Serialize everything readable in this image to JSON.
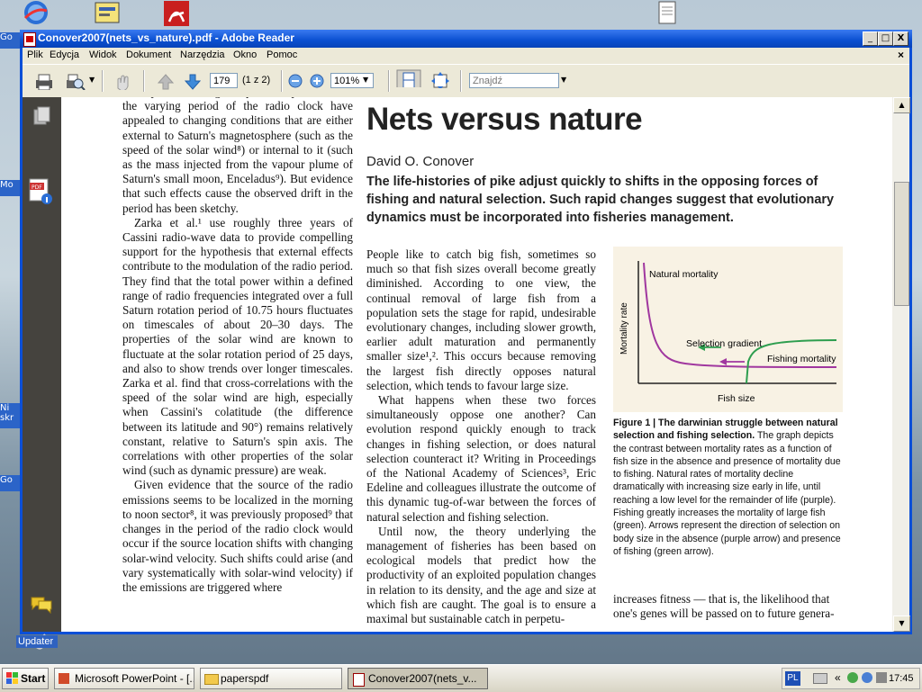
{
  "window": {
    "title": "Conover2007(nets_vs_nature).pdf - Adobe Reader",
    "minimize": "_",
    "maximize": "□",
    "close": "X"
  },
  "menu": [
    "Plik",
    "Edycja",
    "Widok",
    "Dokument",
    "Narzędzia",
    "Okno",
    "Pomoc"
  ],
  "menu_close": "×",
  "toolbar": {
    "page_number": "179",
    "page_count": "(1 z 2)",
    "zoom": "101%",
    "search_placeholder": "Znajdź"
  },
  "desktop": {
    "side_labels": [
      "Go",
      "Mo",
      "Ni skr",
      "Go"
    ],
    "updater": "Updater"
  },
  "article": {
    "col1": [
      "atmosphere and magnetosphere. Explanations of the varying period of the radio clock have appealed to changing conditions that are either external to Saturn's magnetosphere (such as the speed of the solar wind⁸) or internal to it (such as the mass injected from the vapour plume of Saturn's small moon, Enceladus⁹). But evidence that such effects cause the observed drift in the period has been sketchy.",
      "Zarka et al.¹ use roughly three years of Cassini radio-wave data to provide compelling support for the hypothesis that external effects contribute to the modulation of the radio period. They find that the total power within a defined range of radio frequencies integrated over a full Saturn rotation period of 10.75 hours fluctuates on timescales of about 20–30 days. The properties of the solar wind are known to fluctuate at the solar rotation period of 25 days, and also to show trends over longer timescales. Zarka et al. find that cross-correlations with the speed of the solar wind are high, especially when Cassini's colatitude (the difference between its latitude and 90°) remains relatively constant, relative to Saturn's spin axis. The correlations with other properties of the solar wind (such as dynamic pressure) are weak.",
      "Given evidence that the source of the radio emissions seems to be localized in the morning to noon sector⁸, it was previously proposed⁹ that changes in the period of the radio clock would occur if the source location shifts with changing solar-wind velocity. Such shifts could arise (and vary systematically with solar-wind velocity) if the emissions are triggered where"
    ],
    "headline": "Nets versus nature",
    "author": "David O. Conover",
    "standfirst": "The life-histories of pike adjust quickly to shifts in the opposing forces of fishing and natural selection. Such rapid changes suggest that evolutionary dynamics must be incorporated into fisheries management.",
    "col2": [
      "People like to catch big fish, sometimes so much so that fish sizes overall become greatly diminished. According to one view, the continual removal of large fish from a population sets the stage for rapid, undesirable evolutionary changes, including slower growth, earlier adult maturation and permanently smaller size¹,². This occurs because removing the largest fish directly opposes natural selection, which tends to favour large size.",
      "What happens when these two forces simultaneously oppose one another? Can evolution respond quickly enough to track changes in fishing selection, or does natural selection counteract it? Writing in Proceedings of the National Academy of Sciences³, Eric Edeline and colleagues illustrate the outcome of this dynamic tug-of-war between the forces of natural selection and fishing selection.",
      "Until now, the theory underlying the management of fisheries has been based on ecological models that predict how the productivity of an exploited population changes in relation to its density, and the age and size at which fish are caught. The goal is to ensure a maximal but sustainable catch in perpetu-"
    ],
    "figure": {
      "natural_label": "Natural mortality",
      "selection_label": "Selection gradient",
      "fishing_label": "Fishing mortality",
      "ylabel": "Mortality rate",
      "xlabel": "Fish size",
      "colors": {
        "natural": "#a0379f",
        "fishing": "#2e9e4f"
      }
    },
    "caption_title": "Figure 1 | The darwinian struggle between natural selection and fishing selection.",
    "caption_body": "The graph depicts the contrast between mortality rates as a function of fish size in the absence and presence of mortality due to fishing. Natural rates of mortality decline dramatically with increasing size early in life, until reaching a low level for the remainder of life (purple). Fishing greatly increases the mortality of large fish (green). Arrows represent the direction of selection on body size in the absence (purple arrow) and presence of fishing (green arrow).",
    "col3": "increases fitness — that is, the likelihood that one's genes will be passed on to future genera-"
  },
  "taskbar": {
    "start": "Start",
    "tasks": [
      "Microsoft PowerPoint - [...",
      "paperspdf",
      "Conover2007(nets_v..."
    ],
    "lang": "PL",
    "clock": "17:45"
  }
}
